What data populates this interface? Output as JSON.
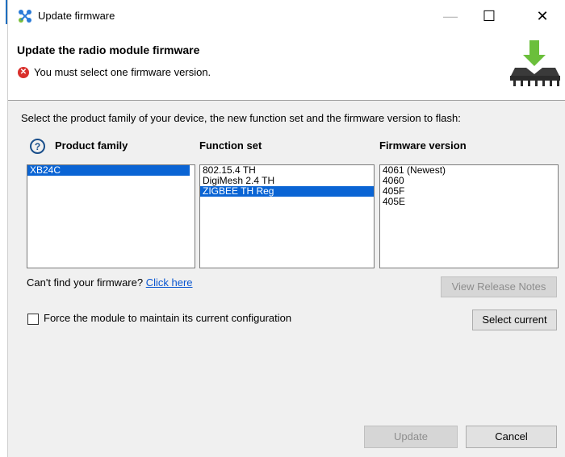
{
  "window": {
    "title": "Update firmware",
    "controls": {
      "minimize": "—",
      "maximize": "☐",
      "close": "✕"
    }
  },
  "header": {
    "title": "Update the radio module firmware",
    "error_message": "You must select one firmware version.",
    "error_icon": "error-icon",
    "image_icon": "firmware-chip-download-icon"
  },
  "main": {
    "instructions": "Select the product family of your device, the new function set and the firmware version to flash:",
    "columns": {
      "product_family": "Product family",
      "function_set": "Function set",
      "firmware_version": "Firmware version"
    },
    "product_families": [
      {
        "label": "XB24C",
        "selected": true
      }
    ],
    "function_sets": [
      {
        "label": "802.15.4 TH",
        "selected": false
      },
      {
        "label": "DigiMesh 2.4 TH",
        "selected": false
      },
      {
        "label": "ZIGBEE TH Reg",
        "selected": true
      }
    ],
    "firmware_versions": [
      {
        "label": "4061 (Newest)",
        "selected": false
      },
      {
        "label": "4060",
        "selected": false
      },
      {
        "label": "405F",
        "selected": false
      },
      {
        "label": "405E",
        "selected": false
      }
    ],
    "cant_find_text": "Can't find your firmware?",
    "click_here": "Click here",
    "view_release_notes": "View Release Notes",
    "force_label": "Force the module to maintain its current configuration",
    "force_checked": false,
    "select_current": "Select current"
  },
  "footer": {
    "update": "Update",
    "cancel": "Cancel"
  },
  "colors": {
    "selection": "#0a64d4",
    "error": "#d9302c",
    "link": "#0b57d0",
    "chip_arrow": "#6bbf3b"
  }
}
